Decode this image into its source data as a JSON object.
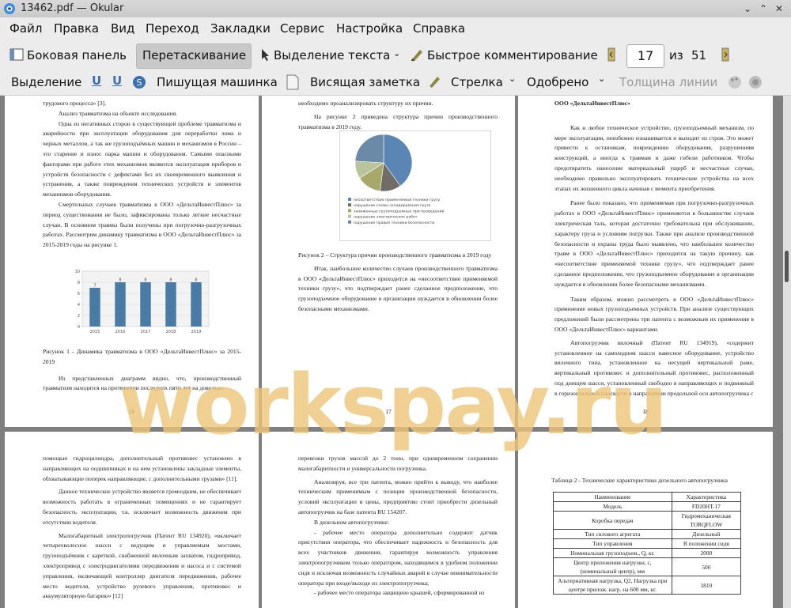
{
  "window": {
    "title": "13462.pdf — Okular",
    "min_label": "⌄",
    "max_label": "⌃",
    "close_label": "✕"
  },
  "menu": [
    "Файл",
    "Правка",
    "Вид",
    "Переход",
    "Закладки",
    "Сервис",
    "Настройка",
    "Справка"
  ],
  "toolbar": {
    "sidebar": "Боковая панель",
    "drag": "Перетаскивание",
    "text_select": "Выделение текста",
    "quick_comment": "Быстрое комментирование",
    "page_current": "17",
    "page_of": "из",
    "page_total": "51"
  },
  "annot_toolbar": {
    "highlight": "Выделение",
    "typewriter": "Пишущая машинка",
    "sticky": "Висящая заметка",
    "arrow": "Стрелка",
    "stamp": "Одобрено",
    "line_width": "Толщина линии"
  },
  "watermark": "workspay.ru",
  "pages": {
    "p16": {
      "lines": [
        "трудового процесса» [3].",
        "Анализ травматизма на объекте исследования.",
        "Одна из негативных сторон в существующей проблеме травматизма и аварийности при эксплуатации оборудования для переработки лома и черных металлов, а так же грузоподъёмных машин и механизмов в России – это старение и износ парка машин и оборудования. Самыми опасными факторами при работе этих механизмов являются эксплуатация приборов и устройств безопасности с дефектами без их своевременного выявления и устранения, а также повреждения технических устройств и элементов механизмов оборудования.",
        "Смертельных случаев травматизма в ООО «ДельтаИнвестПлюс» за период существования не было, зафиксированы только легкие несчастные случаи. В основном травмы были получены при погрузочно-разгрузочных работах. Рассмотрим динамику травматизма в ООО «ДельтаИнвестПлюс» за 2015-2019 годы на рисунке 1."
      ],
      "caption": "Рисунок 1 - Динамика травматизма в ООО «ДельтаИнвестПлюс» за 2015-2019",
      "after": "Из представленных диаграмм видно, что, производственный травматизм находится на протяжении последних пяти лет на довольно",
      "num": "16"
    },
    "p17": {
      "top": "необходимо проанализировать структуру их причин.",
      "intro": "На рисунке 2 приведена структура причин производственного травматизма в 2019 году.",
      "caption": "Рисунок 2 – Структура причин производственного травматизма в 2019 году",
      "body": "Итак, наибольшее количество случаев производственного травматизма в ООО «ДельтаИнвестПлюс» приходится на «несоответствие применяемой техники грузу», что подтверждает ранее сделанное предположение, что грузоподъемное оборудование в организации нуждается в обновлении более безопасными механизмами.",
      "num": "17"
    },
    "p18": {
      "heading": "ООО «ДельтаИнвестПлюс»",
      "paras": [
        "Как и любое техническое устройство, грузоподъемный механизм, по мере эксплуатации, неизбежно изнашивается и выходит из строя. Это может привести к остановкам, повреждению оборудования, разрушениям конструкций, а иногда к травмам и даже гибели работников. Чтобы предотвратить нанесение материальный ущерб и несчастные случаи, необходимо правильно эксплуатировать технические устройства на всех этапах их жизненного цикла начиная с момента приобретения.",
        "Ранее было показано, что применяемая при погрузочно-разгрузочных работах в ООО «ДельтаИнвестПлюс» применяется в большинстве случаев электрическая таль, которая достаточно требовательна при обслуживании, характеру груза и условиям погрузки. Также при анализе производственной безопасности и охраны труда было выявлено, что наибольшее количество травм в ООО «ДельтаИнвестПлюс» приходится на такую причину, как «несоответствие применяемой технике грузу», что подтверждает ранее сделанное предположение, что грузоподъемное оборудование в организации нуждается в обновлении более безопасными механизмами.",
        "Таким образом, можно рассмотреть в ООО «ДельтаИнвестПлюс» применение новых грузоподъемных устройств. При анализе существующих предложений были рассмотрены три патента с возможным их применения в ООО «ДельтаИнвестПлюс» вариантами.",
        "Автопогрузчик вилочный (Патент RU 134919), «содержит установленное на самоходном шасси навесное оборудование, устройство вилочного типа, установленное на несущей вертикальной раме, вертикальный противовес и дополнительный противовес, расположенный под днищем шасси, установленный свободно в направляющих и подвижный в горизонтальной плоскости в направлении продольной оси автопогрузчика с"
      ],
      "num": "18"
    },
    "p19": {
      "paras": [
        "помощью гидроцилиндра, дополнительный противовес установлен в направляющих на подшипниках и на нем установлены закладные элементы, обхватывающие поперек направляющие, с дополнительными грузами» [11].",
        "Данное техническое устройство является громоздким, не обеспечивает возможность работать в ограниченных помещениях и не гарантирует безопасность эксплуатации, т.к. исключает возможность движения при отсутствии водителя.",
        "Малогабаритный электропогрузчик (Патент RU 134920), «включает четырехколесное шасси с ведущим и управляемым мостами, грузоподъёмник с кареткой, снабженной вилочным захватом, гидропривод, электропривод с электродвигателями передвижения и насоса и с системой управления, включающей контроллер двигателя передвижения, рабочее место водителя, устройство рулевого управления, противовес и аккумуляторную батарею» [12]"
      ]
    },
    "p20": {
      "paras": [
        "перевозки грузов массой до 2 тонн, при одновременном сохранении малогабаритности и универсальности погрузчика.",
        "Анализируя, все три патента, можно прийти к выводу, что наиболее техническим применимым с позиции производственной безопасности, условий эксплуатации и цены, предприятию стоит приобрести дизельный автопогрузчик на базе патента RU 154207.",
        "В дизельном автопогрузчике:",
        "- рабочее место оператора дополнительно содержит датчик присутствия оператора, что обеспечивает надежность и безопасность для всех участников движения, гарантируя возможность управления электропогрузчиком только оператором, находящимся в удобном положении сидя и исключая возможность случайных аварий в случае невнимательности оператора при входе/выходе из электропогрузчика;",
        "- рабочее место оператора защищено крышей, сформированной из"
      ]
    },
    "p21": {
      "caption": "Таблица 2 - Технические характеристики дизельного автопогрузчика",
      "rows": [
        [
          "Наименование",
          "Характеристика"
        ],
        [
          "Модель",
          "FD20HT-17"
        ],
        [
          "Коробка передач",
          "Гидромеханическая TORQFLOW"
        ],
        [
          "Тип силового агрегата",
          "Дизельный"
        ],
        [
          "Тип управления",
          "В положении сидя"
        ],
        [
          "Номинальная грузоподъем., Q, кг.",
          "2000"
        ],
        [
          "Центр приложения нагрузки, с, (номинальный центр), мм",
          "500"
        ],
        [
          "Альтернативная нагрузка, Q2, Нагрузка при центре прилож. нагр. на 600 мм, кг.",
          "1810"
        ]
      ]
    }
  },
  "chart_data": [
    {
      "type": "bar",
      "title": "",
      "categories": [
        "2015",
        "2016",
        "2017",
        "2018",
        "2019"
      ],
      "values": [
        7,
        8,
        8,
        8,
        8
      ],
      "ylim": [
        0,
        10
      ],
      "color": "#4a7aa6"
    },
    {
      "type": "pie",
      "title": "",
      "labels": [
        "несоответствие применяемой техники грузу",
        "нарушение схемы складирования груза",
        "заниженные грузоподъемные при проведении",
        "нарушение электрических работ",
        "нарушение правил техники безопасности"
      ],
      "values": [
        40,
        12,
        14,
        10,
        24
      ],
      "colors": [
        "#5b85b4",
        "#6f6d65",
        "#a8a86a",
        "#b9c39c",
        "#6a8aa8"
      ]
    }
  ]
}
